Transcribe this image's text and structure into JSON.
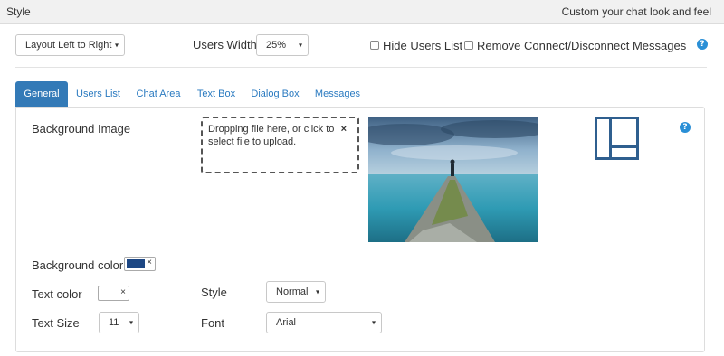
{
  "header": {
    "title": "Style",
    "subtitle": "Custom your chat look and feel"
  },
  "toolbar": {
    "layout_select": "Layout Left to Right",
    "users_width_label": "Users Width",
    "users_width_value": "25%",
    "hide_users_label": "Hide Users List",
    "remove_msgs_label": "Remove Connect/Disconnect Messages",
    "help": "?"
  },
  "tabs": [
    {
      "label": "General",
      "active": true
    },
    {
      "label": "Users List"
    },
    {
      "label": "Chat Area"
    },
    {
      "label": "Text Box"
    },
    {
      "label": "Dialog Box"
    },
    {
      "label": "Messages"
    }
  ],
  "general": {
    "bg_image_label": "Background Image",
    "dropzone_text": "Dropping file here, or click to select file to upload.",
    "dropzone_close": "×",
    "help": "?",
    "bg_color_label": "Background color",
    "bg_color_value": "#1d4784",
    "text_color_label": "Text color",
    "style_label": "Style",
    "style_value": "Normal",
    "text_size_label": "Text Size",
    "text_size_value": "11",
    "font_label": "Font",
    "font_value": "Arial",
    "clear": "×"
  },
  "icons": {
    "caret": "▾",
    "layout_preview": "layout-preview-icon",
    "help": "help-icon"
  },
  "colors": {
    "accent": "#337ab7",
    "help_icon": "#2a8fd6",
    "layout_icon": "#2f5f8f"
  }
}
